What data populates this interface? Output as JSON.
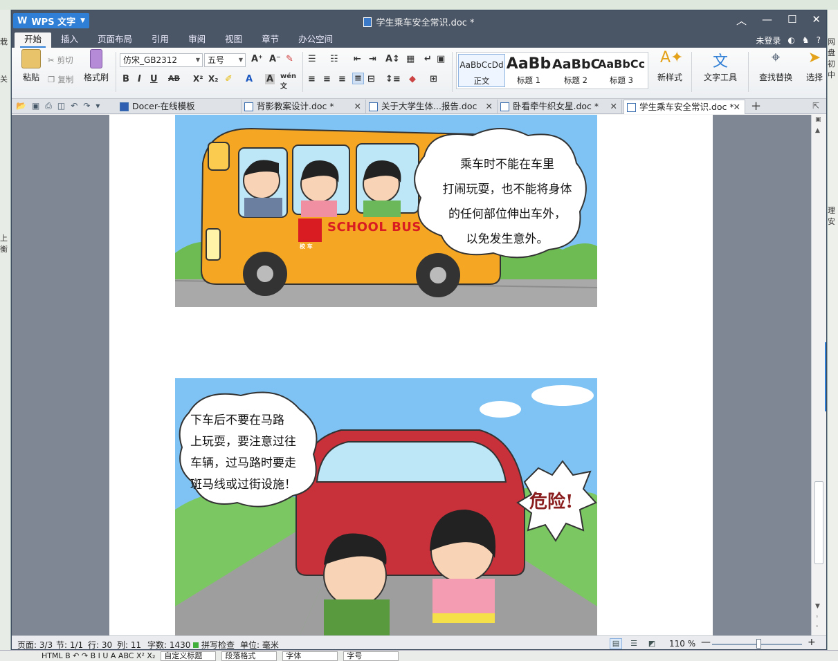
{
  "window": {
    "app_name": "WPS 文字",
    "title": "学生乘车安全常识.doc *",
    "controls": [
      "︿",
      "—",
      "☐",
      "✕"
    ]
  },
  "menu": {
    "tabs": [
      "开始",
      "插入",
      "页面布局",
      "引用",
      "审阅",
      "视图",
      "章节",
      "办公空间"
    ],
    "login": "未登录",
    "help": "?"
  },
  "ribbon": {
    "paste": "粘贴",
    "cut": "剪切",
    "copy": "复制",
    "format_painter": "格式刷",
    "font_name": "仿宋_GB2312",
    "font_size": "五号",
    "styles": [
      {
        "preview": "AaBbCcDd",
        "label": "正文"
      },
      {
        "preview": "AaBb",
        "label": "标题 1"
      },
      {
        "preview": "AaBbC",
        "label": "标题 2"
      },
      {
        "preview": "AaBbCc",
        "label": "标题 3"
      }
    ],
    "new_style": "新样式",
    "text_tools": "文字工具",
    "find_replace": "查找替换",
    "select": "选择"
  },
  "doc_tabs": [
    {
      "label": "Docer-在线模板",
      "active": false
    },
    {
      "label": "背影教案设计.doc *",
      "active": false
    },
    {
      "label": "关于大学生体...报告.doc",
      "active": false
    },
    {
      "label": "卧看牵牛织女星.doc *",
      "active": false
    },
    {
      "label": "学生乘车安全常识.doc *",
      "active": true
    }
  ],
  "content": {
    "image1": {
      "bubble_lines": [
        "乘车时不能在车里",
        "打闹玩耍，也不能将身体",
        "的任何部位伸出车外，",
        "以免发生意外。"
      ],
      "bus_text": "SCHOOL BUS",
      "badge_text": "校 车"
    },
    "image2": {
      "bubble_lines": [
        "下车后不要在马路",
        "上玩耍，要注意过往",
        "车辆，过马路时要走",
        "斑马线或过街设施！"
      ],
      "danger_text": "危险!"
    }
  },
  "statusbar": {
    "page": "页面: 3/3",
    "section": "节: 1/1",
    "row": "行: 30",
    "col": "列: 11",
    "words": "字数: 1430",
    "spellcheck": "拼写检查",
    "unit": "单位: 毫米",
    "zoom": "110 %"
  },
  "background": {
    "left_labels": [
      "栽",
      "关",
      "上衡"
    ],
    "right_labels": [
      "网盘",
      "初中",
      "理安"
    ],
    "taskbar_items": [
      "自定义标题",
      "段落格式",
      "字体",
      "字号"
    ]
  },
  "colors": {
    "titlebar": "#4a5565",
    "accent": "#2f7fd6",
    "sky": "#7ec3f3",
    "grass": "#7bc862",
    "bus": "#f5a623"
  }
}
